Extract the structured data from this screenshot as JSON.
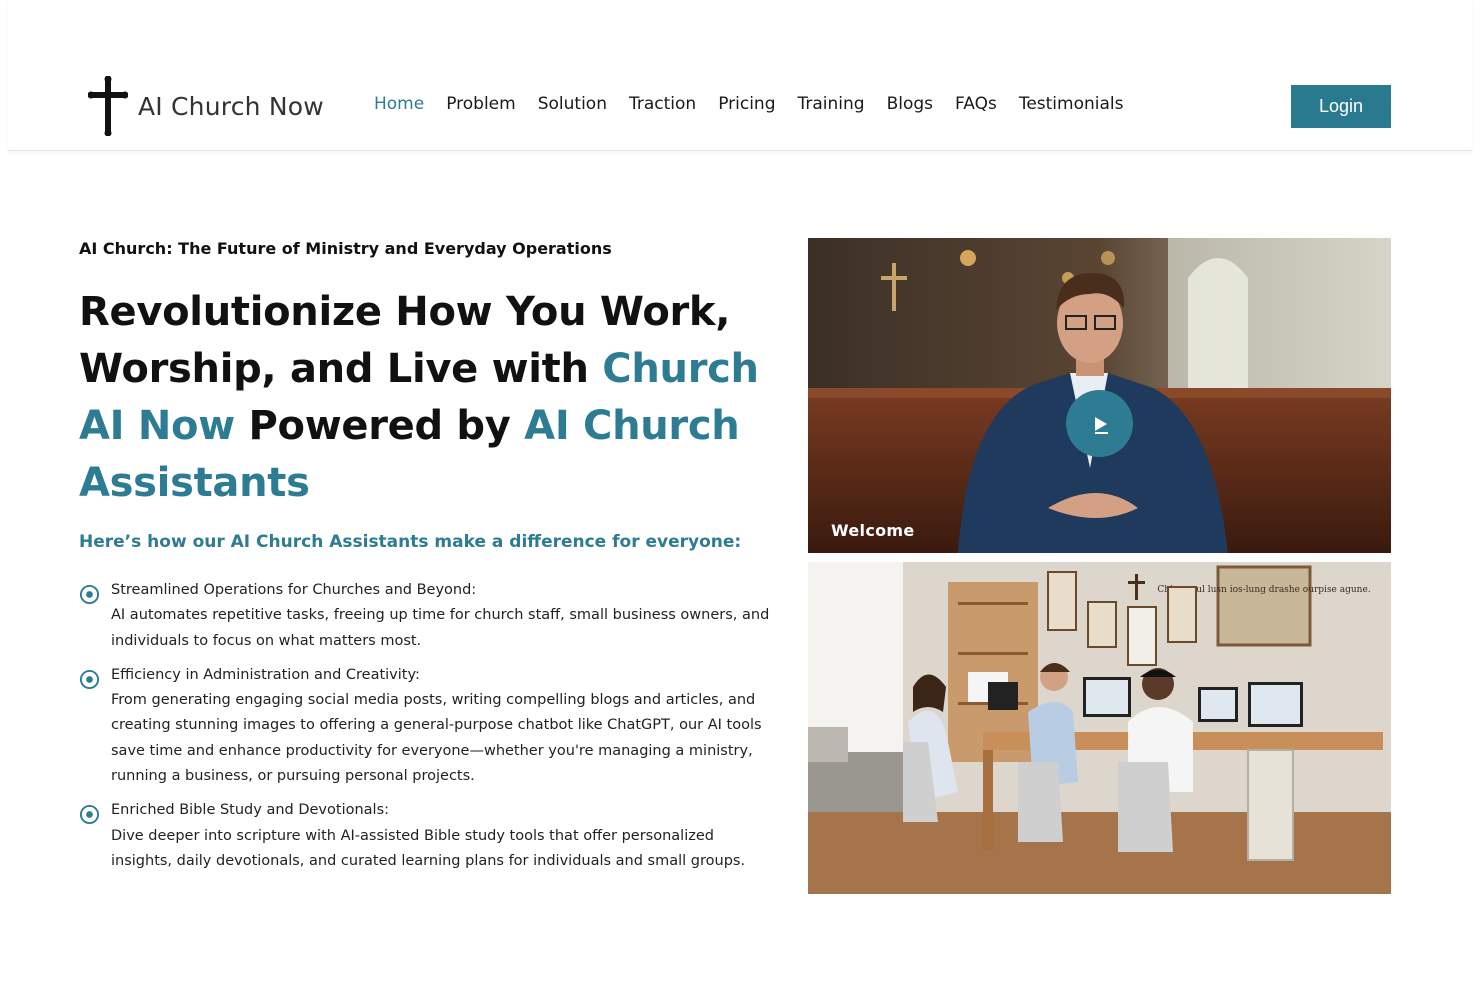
{
  "brand": {
    "name": "AI Church Now"
  },
  "nav": {
    "items": [
      {
        "label": "Home",
        "active": true
      },
      {
        "label": "Problem"
      },
      {
        "label": "Solution"
      },
      {
        "label": "Traction"
      },
      {
        "label": "Pricing"
      },
      {
        "label": "Training"
      },
      {
        "label": "Blogs"
      },
      {
        "label": "FAQs"
      },
      {
        "label": "Testimonials"
      }
    ],
    "login_label": "Login"
  },
  "hero": {
    "kicker": "AI Church: The Future of Ministry and Everyday Operations",
    "headline_part1": "Revolutionize How You Work, Worship, and Live with ",
    "headline_accent1": "Church AI Now",
    "headline_part2": " Powered by ",
    "headline_accent2": "AI Church Assistants",
    "subhead": "Here’s how our AI Church Assistants make a difference for everyone:",
    "features": [
      {
        "title": "Streamlined Operations for Churches and Beyond:",
        "body": "AI automates repetitive tasks, freeing up time for church staff, small business owners, and individuals to focus on what matters most."
      },
      {
        "title": "Efficiency in Administration and Creativity:",
        "body": "From generating engaging social media posts, writing compelling blogs and articles, and creating stunning images to offering a general-purpose chatbot like ChatGPT, our AI tools save time and enhance productivity for everyone—whether you're managing a ministry, running a business, or pursuing personal projects."
      },
      {
        "title": "Enriched Bible Study and Devotionals:",
        "body": "Dive deeper into scripture with AI-assisted Bible study tools that offer personalized insights, daily devotionals, and curated learning plans for individuals and small groups."
      }
    ]
  },
  "video": {
    "label": "Welcome"
  },
  "office_poster": {
    "text": "Chise youl lusn ios-lung drashe ourpise agune."
  },
  "colors": {
    "accent": "#2e7c93",
    "login_bg": "#2a7a8f"
  }
}
